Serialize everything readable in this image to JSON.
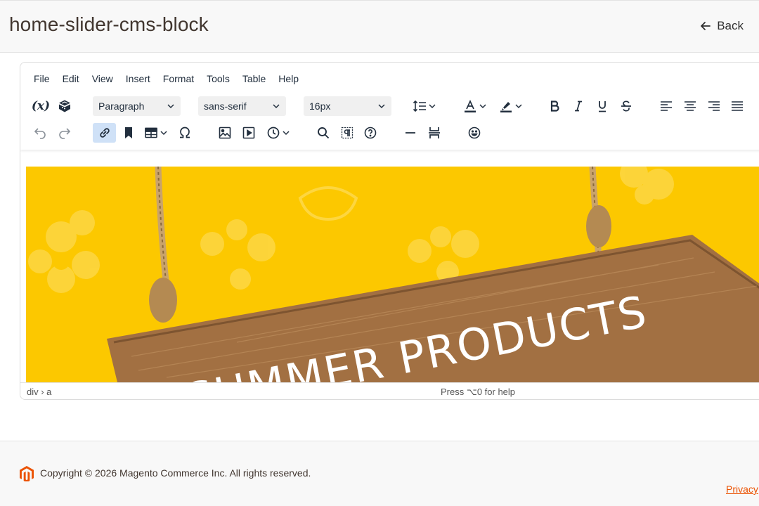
{
  "page": {
    "title": "home-slider-cms-block",
    "back_label": "Back"
  },
  "editor": {
    "menu": [
      "File",
      "Edit",
      "View",
      "Insert",
      "Format",
      "Tools",
      "Table",
      "Help"
    ],
    "block_format": "Paragraph",
    "font_family": "sans-serif",
    "font_size": "16px",
    "variable_icon_text": "(x)",
    "toolbar_row1_icons": [
      "insert-variable-icon",
      "insert-widget-icon",
      "line-height-icon",
      "text-color-icon",
      "highlight-color-icon",
      "bold-icon",
      "italic-icon",
      "underline-icon",
      "strikethrough-icon",
      "align-left-icon",
      "align-center-icon",
      "align-right-icon",
      "justify-icon"
    ],
    "toolbar_row2_icons": [
      "undo-icon",
      "redo-icon",
      "link-icon",
      "bookmark-icon",
      "table-icon",
      "special-character-icon",
      "image-icon",
      "media-icon",
      "datetime-icon",
      "search-replace-icon",
      "visual-blocks-icon",
      "help-icon",
      "horizontal-rule-icon",
      "page-break-icon",
      "emoticons-icon"
    ],
    "active_tool": "link-icon",
    "banner": {
      "sign_text": "SUMMER PRODUCTS",
      "background_color": "#fcc800"
    },
    "status_path": "div › a",
    "help_hint": "Press ⌥0 for help"
  },
  "footer": {
    "copyright": "Copyright © 2026 Magento Commerce Inc. All rights reserved.",
    "privacy_label": "Privacy"
  },
  "colors": {
    "accent": "#eb5202",
    "active_tool_bg": "#cfe1f7"
  }
}
